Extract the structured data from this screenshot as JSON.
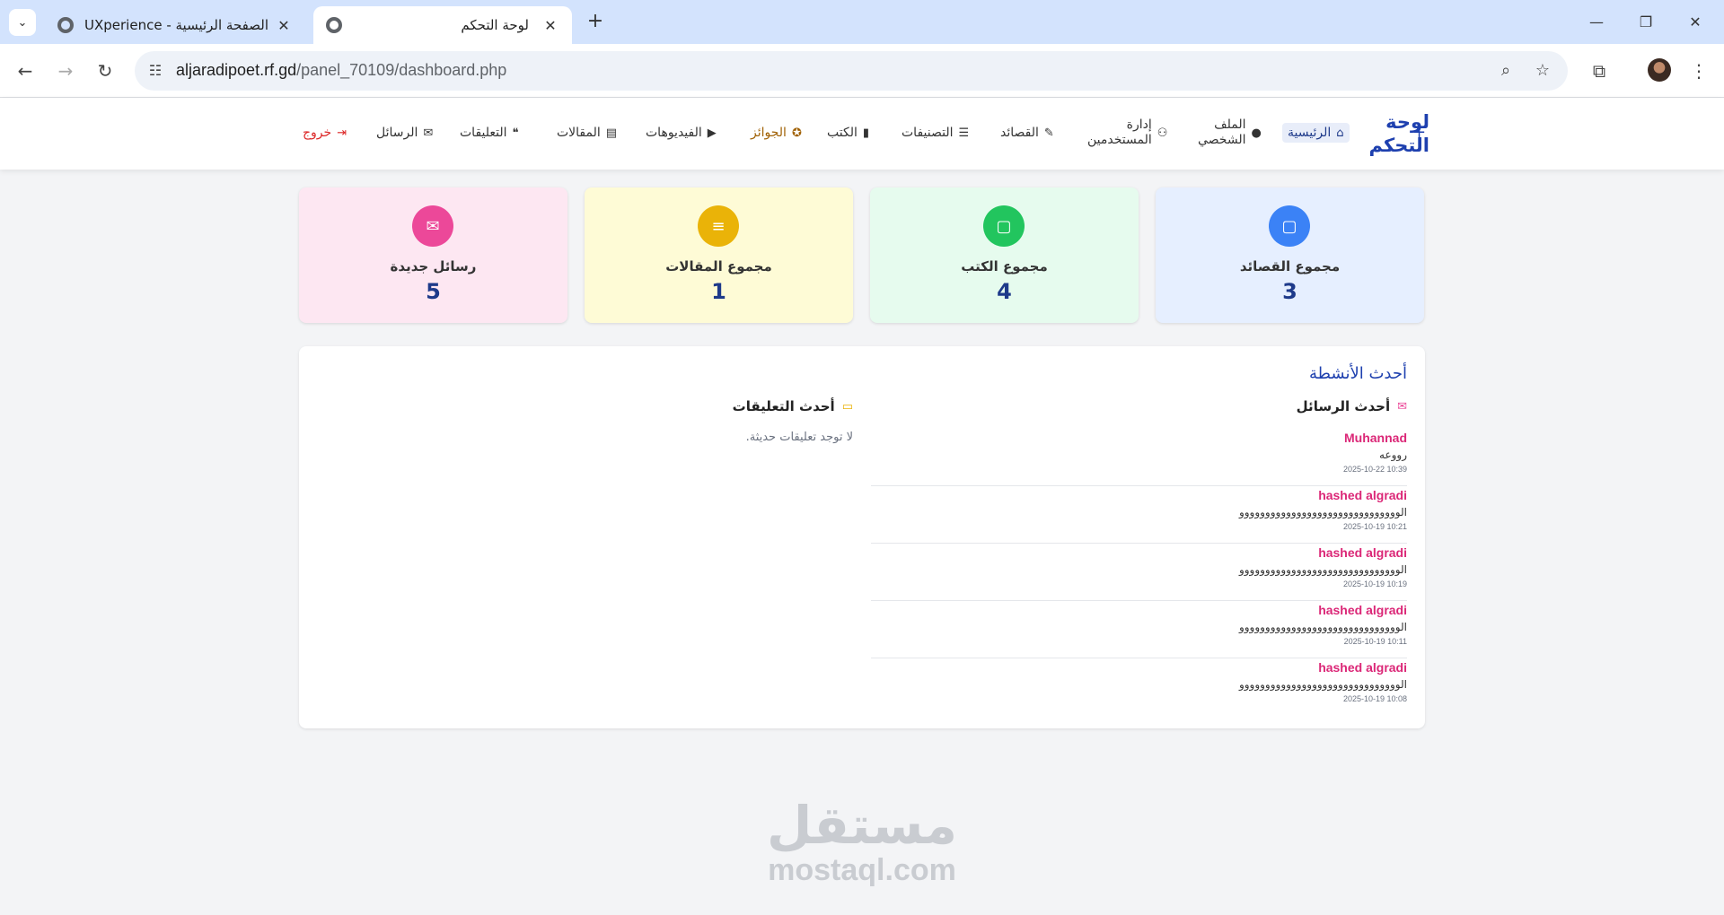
{
  "browser": {
    "tabs": [
      {
        "title": "UXperience - الصفحة الرئيسية",
        "active": false
      },
      {
        "title": "لوحة التحكم",
        "active": true
      }
    ],
    "url_host": "aljaradipoet.rf.gd",
    "url_path": "/panel_70109/dashboard.php"
  },
  "header": {
    "brand": "لوحة التحكم",
    "nav": {
      "home": "الرئيسية",
      "profile_1": "الملف",
      "profile_2": "الشخصي",
      "users_1": "إدارة",
      "users_2": "المستخدمين",
      "poems": "القصائد",
      "categories": "التصنيفات",
      "books": "الكتب",
      "awards": "الجوائز",
      "videos": "الفيديوهات",
      "articles": "المقالات",
      "comments": "التعليقات",
      "messages": "الرسائل",
      "logout": "خروج"
    }
  },
  "stats": [
    {
      "label": "مجموع القصائد",
      "value": "3"
    },
    {
      "label": "مجموع الكتب",
      "value": "4"
    },
    {
      "label": "مجموع المقالات",
      "value": "1"
    },
    {
      "label": "رسائل جديدة",
      "value": "5"
    }
  ],
  "activity": {
    "title": "أحدث الأنشطة",
    "messages_heading": "أحدث الرسائل",
    "comments_heading": "أحدث التعليقات",
    "no_comments": "لا توجد تعليقات حديثة.",
    "messages": [
      {
        "name": "Muhannad",
        "body": "رووعه",
        "time": "2025-10-22 10:39"
      },
      {
        "name": "hashed algradi",
        "body": "الووووووووووووووووووووووووووووووو",
        "time": "2025-10-19 10:21"
      },
      {
        "name": "hashed algradi",
        "body": "الووووووووووووووووووووووووووووووو",
        "time": "2025-10-19 10:19"
      },
      {
        "name": "hashed algradi",
        "body": "الووووووووووووووووووووووووووووووو",
        "time": "2025-10-19 10:11"
      },
      {
        "name": "hashed algradi",
        "body": "الووووووووووووووووووووووووووووووو",
        "time": "2025-10-19 10:08"
      }
    ]
  },
  "watermark": {
    "arabic": "مستقل",
    "latin": "mostaql.com"
  },
  "icons": {
    "home": "home-icon",
    "profile": "user-icon",
    "users": "users-icon",
    "poems": "feather-icon",
    "categories": "list-icon",
    "books": "book-icon",
    "awards": "award-icon",
    "videos": "video-icon",
    "articles": "newspaper-icon",
    "comments": "comments-icon",
    "messages": "envelope-icon",
    "logout": "logout-icon"
  },
  "colors": {
    "brand": "#1e40af",
    "accent_pink": "#db2777",
    "logout": "#dc2626",
    "awards": "#a16207"
  }
}
